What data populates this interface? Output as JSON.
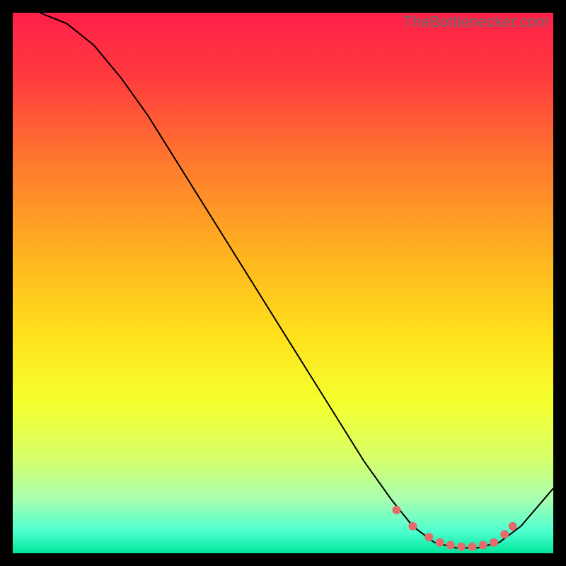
{
  "watermark": "TheBottlenecker.com",
  "chart_data": {
    "type": "line",
    "title": "",
    "xlabel": "",
    "ylabel": "",
    "xlim": [
      0,
      100
    ],
    "ylim": [
      0,
      100
    ],
    "grid": false,
    "background_gradient": {
      "stops": [
        {
          "offset": 0.0,
          "color": "#ff1f49"
        },
        {
          "offset": 0.12,
          "color": "#ff3b3e"
        },
        {
          "offset": 0.28,
          "color": "#ff7a2d"
        },
        {
          "offset": 0.45,
          "color": "#ffb41f"
        },
        {
          "offset": 0.6,
          "color": "#ffe21c"
        },
        {
          "offset": 0.72,
          "color": "#f5ff2e"
        },
        {
          "offset": 0.82,
          "color": "#d8ff66"
        },
        {
          "offset": 0.9,
          "color": "#a8ffb0"
        },
        {
          "offset": 0.96,
          "color": "#4dffd0"
        },
        {
          "offset": 1.0,
          "color": "#00e69a"
        }
      ]
    },
    "series": [
      {
        "name": "bottleneck-curve",
        "stroke": "#000000",
        "stroke_width": 2,
        "x": [
          5,
          10,
          15,
          20,
          25,
          30,
          35,
          40,
          45,
          50,
          55,
          60,
          65,
          70,
          74,
          78,
          82,
          86,
          90,
          94,
          100
        ],
        "y": [
          100,
          98,
          94,
          88,
          81,
          73,
          65,
          57,
          49,
          41,
          33,
          25,
          17,
          10,
          5,
          2,
          1,
          1,
          2,
          5,
          12
        ]
      }
    ],
    "markers": {
      "name": "highlight-dots",
      "color": "#e66a6a",
      "radius": 6,
      "points": [
        {
          "x": 71,
          "y": 8
        },
        {
          "x": 74,
          "y": 5
        },
        {
          "x": 77,
          "y": 3
        },
        {
          "x": 79,
          "y": 2
        },
        {
          "x": 81,
          "y": 1.5
        },
        {
          "x": 83,
          "y": 1.2
        },
        {
          "x": 85,
          "y": 1.2
        },
        {
          "x": 87,
          "y": 1.5
        },
        {
          "x": 89,
          "y": 2
        },
        {
          "x": 91,
          "y": 3.5
        },
        {
          "x": 92.5,
          "y": 5
        }
      ]
    }
  }
}
